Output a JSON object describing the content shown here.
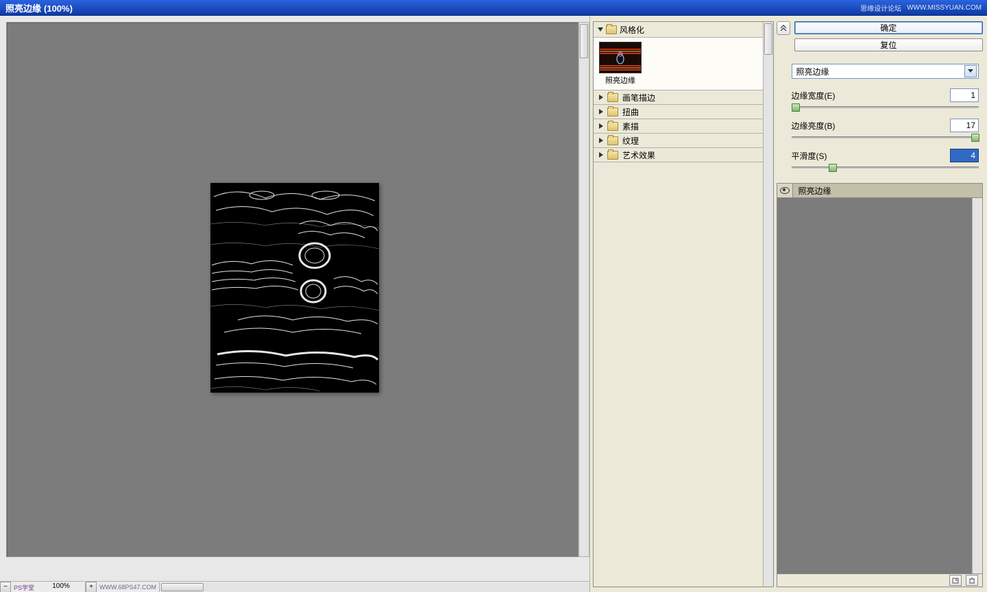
{
  "titlebar": {
    "title": "照亮边缘",
    "zoom": "(100%)",
    "brand": "思缘设计论坛",
    "site": "WWW.MISSYUAN.COM"
  },
  "tree": {
    "root": "风格化",
    "thumb_label": "照亮边缘",
    "categories": [
      "画笔描边",
      "扭曲",
      "素描",
      "纹理",
      "艺术效果"
    ]
  },
  "controls": {
    "ok": "确定",
    "reset": "复位",
    "dropdown": "照亮边缘",
    "params": [
      {
        "label": "边缘宽度(E)",
        "value": "1",
        "pos": 0
      },
      {
        "label": "边缘亮度(B)",
        "value": "17",
        "pos": 96
      },
      {
        "label": "平滑度(S)",
        "value": "4",
        "pos": 20,
        "selected": true
      }
    ]
  },
  "layer": {
    "name": "照亮边缘"
  },
  "status": {
    "zoom": "100%",
    "badge": "PS学堂",
    "badge2": "WWW.68PS47.COM"
  }
}
